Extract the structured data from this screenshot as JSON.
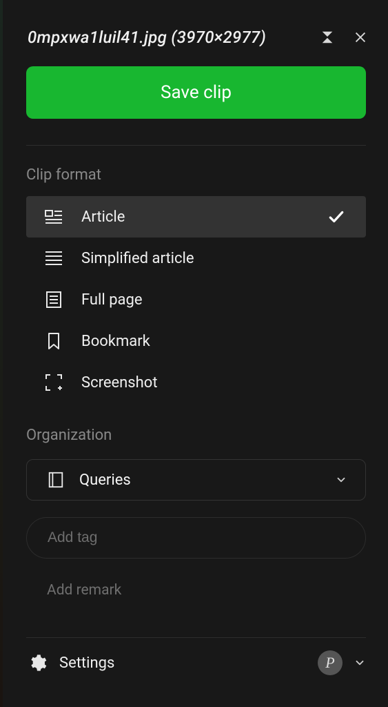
{
  "header": {
    "title": "0mpxwa1luil41.jpg (3970×2977)"
  },
  "save_button": {
    "label": "Save clip"
  },
  "clip_format": {
    "section_label": "Clip format",
    "items": [
      {
        "label": "Article",
        "icon": "article-icon",
        "selected": true
      },
      {
        "label": "Simplified article",
        "icon": "simplified-article-icon",
        "selected": false
      },
      {
        "label": "Full page",
        "icon": "full-page-icon",
        "selected": false
      },
      {
        "label": "Bookmark",
        "icon": "bookmark-icon",
        "selected": false
      },
      {
        "label": "Screenshot",
        "icon": "screenshot-icon",
        "selected": false
      }
    ]
  },
  "organization": {
    "section_label": "Organization",
    "notebook": "Queries",
    "tag_placeholder": "Add tag",
    "remark": "Add remark"
  },
  "footer": {
    "settings_label": "Settings",
    "avatar_initial": "P"
  }
}
